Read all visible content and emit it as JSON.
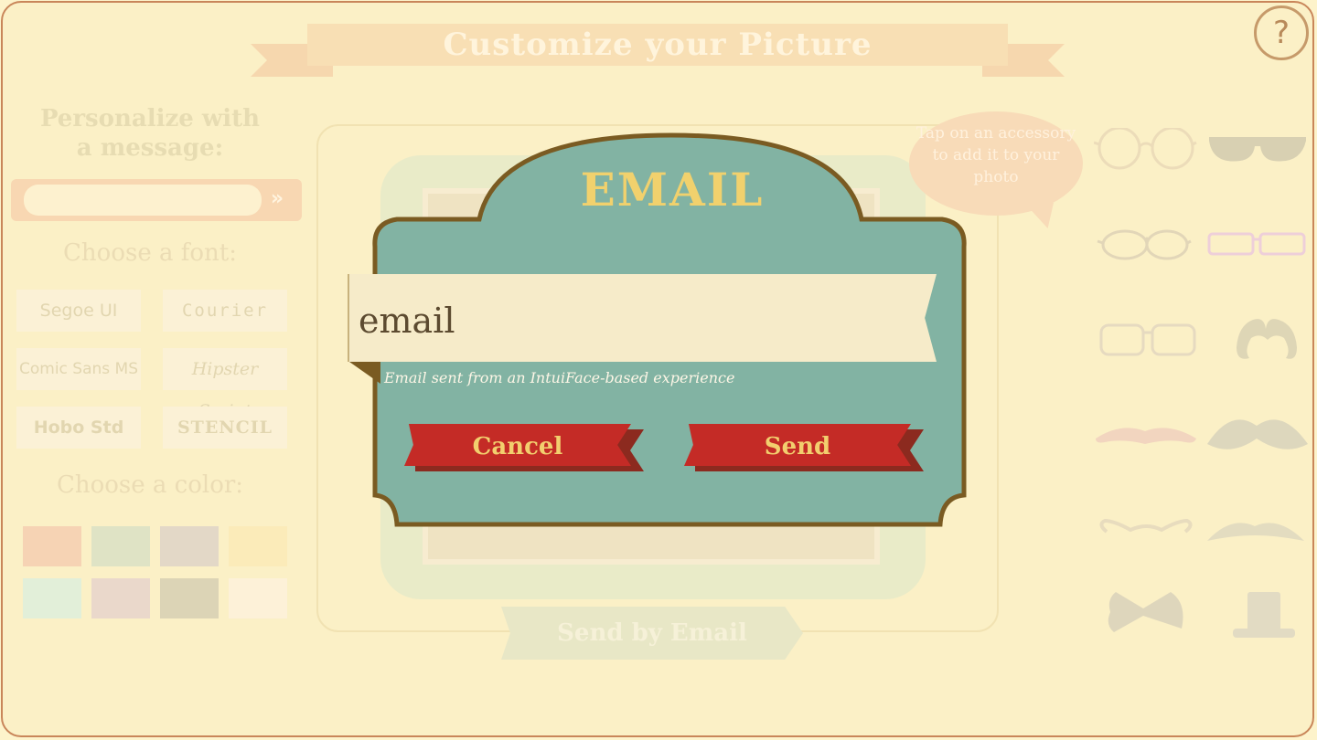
{
  "header": {
    "title": "Customize your Picture",
    "help_label": "?"
  },
  "left_panel": {
    "personalize_label_line1": "Personalize with",
    "personalize_label_line2": "a message:",
    "go_label": "»",
    "font_label": "Choose a font:",
    "fonts": [
      "Segoe UI",
      "Courier",
      "Comic Sans MS",
      "Hipster Script",
      "Hobo Std",
      "STENCIL"
    ],
    "color_label": "Choose a color:",
    "colors": [
      "#f6d3b4",
      "#dfe3c5",
      "#e3d8c7",
      "#fbebb9",
      "#e2efd9",
      "#ead8cb",
      "#dcd4b6",
      "#fdf1d8"
    ]
  },
  "center": {
    "send_by_email_label": "Send by Email"
  },
  "right_panel": {
    "tip_text": "Tap on an accessory to add it to your photo",
    "accessories": [
      "round-glasses",
      "sunglasses",
      "oval-glasses",
      "pink-glasses",
      "square-glasses",
      "curly-mustache",
      "thin-mustache",
      "bushy-mustache",
      "handlebar-mustache",
      "chevron-mustache",
      "bow-tie",
      "top-hat"
    ]
  },
  "dialog": {
    "title": "EMAIL",
    "email_placeholder": "email",
    "note": "Email sent from an IntuiFace-based experience",
    "cancel_label": "Cancel",
    "send_label": "Send",
    "accent": "#82b3a3"
  }
}
